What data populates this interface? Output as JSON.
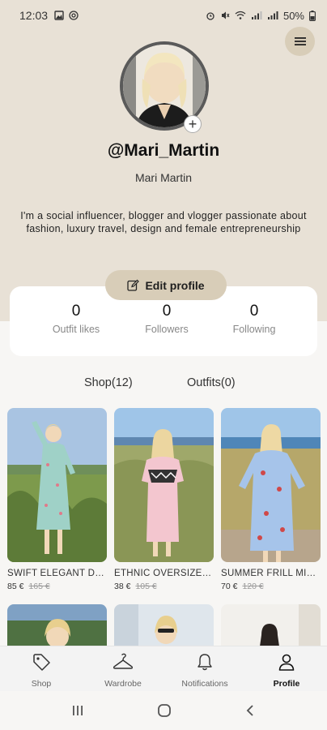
{
  "status_bar": {
    "time": "12:03",
    "battery": "50%",
    "icons": [
      "image-icon",
      "at-icon",
      "alarm-icon",
      "mute-icon",
      "wifi-icon",
      "signal-icon",
      "signal-icon",
      "battery-icon"
    ]
  },
  "profile": {
    "username": "@Mari_Martin",
    "full_name": "Mari Martin",
    "bio": "I'm a social influencer, blogger and vlogger passionate about fashion, luxury travel, design and female entrepreneurship",
    "add_photo_label": "+",
    "edit_label": "Edit profile"
  },
  "stats": [
    {
      "value": "0",
      "label": "Outfit likes"
    },
    {
      "value": "0",
      "label": "Followers"
    },
    {
      "value": "0",
      "label": "Following"
    }
  ],
  "tabs": [
    {
      "label": "Shop(12)",
      "active": true
    },
    {
      "label": "Outfits(0)",
      "active": false
    }
  ],
  "products": [
    {
      "name": "SWIFT ELEGANT DRESS",
      "price": "85 €",
      "old_price": "165 €"
    },
    {
      "name": "ETHNIC OVERSIZE DRESS",
      "price": "38 €",
      "old_price": "105 €"
    },
    {
      "name": "SUMMER FRILL MINI DRESS",
      "price": "70 €",
      "old_price": "120 €"
    }
  ],
  "bottom_nav": [
    {
      "label": "Shop",
      "icon": "tag-icon",
      "active": false
    },
    {
      "label": "Wardrobe",
      "icon": "hanger-icon",
      "active": false
    },
    {
      "label": "Notifications",
      "icon": "bell-icon",
      "active": false
    },
    {
      "label": "Profile",
      "icon": "person-icon",
      "active": true
    }
  ],
  "colors": {
    "header_bg": "#e8e1d6",
    "accent": "#d8cdb8",
    "page_bg": "#f7f6f4"
  }
}
